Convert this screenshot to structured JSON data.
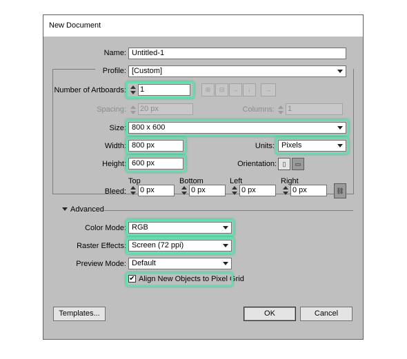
{
  "dialog": {
    "title": "New Document",
    "name": {
      "label": "Name:",
      "value": "Untitled-1"
    },
    "profile": {
      "label": "Profile:",
      "value": "[Custom]"
    },
    "artboards": {
      "label": "Number of Artboards:",
      "value": "1"
    },
    "spacing": {
      "label": "Spacing:",
      "value": "20 px"
    },
    "columns": {
      "label": "Columns:",
      "value": "1"
    },
    "size": {
      "label": "Size:",
      "value": "800 x 600"
    },
    "width": {
      "label": "Width:",
      "value": "800 px"
    },
    "units": {
      "label": "Units:",
      "value": "Pixels"
    },
    "height": {
      "label": "Height:",
      "value": "600 px"
    },
    "orientation": {
      "label": "Orientation:"
    },
    "bleed": {
      "label": "Bleed:",
      "top": {
        "label": "Top",
        "value": "0 px"
      },
      "bottom": {
        "label": "Bottom",
        "value": "0 px"
      },
      "left": {
        "label": "Left",
        "value": "0 px"
      },
      "right": {
        "label": "Right",
        "value": "0 px"
      }
    },
    "advanced": {
      "label": "Advanced",
      "color_mode": {
        "label": "Color Mode:",
        "value": "RGB"
      },
      "raster_effects": {
        "label": "Raster Effects:",
        "value": "Screen (72 ppi)"
      },
      "preview_mode": {
        "label": "Preview Mode:",
        "value": "Default"
      },
      "align_pixel_grid": {
        "label": "Align New Objects to Pixel Grid",
        "checked": true
      }
    },
    "buttons": {
      "templates": "Templates...",
      "ok": "OK",
      "cancel": "Cancel"
    },
    "highlight_color": "#67dcae"
  }
}
